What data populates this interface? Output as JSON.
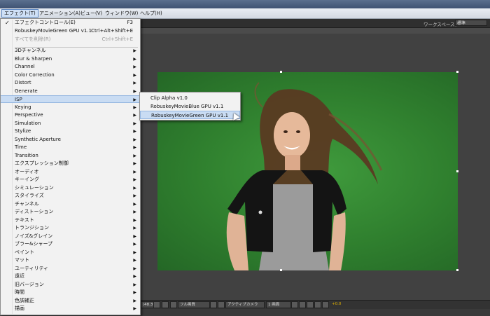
{
  "menubar": {
    "items": [
      {
        "label": "エフェクト(T)",
        "active": true
      },
      {
        "label": "アニメーション(A)",
        "active": false
      },
      {
        "label": "ビュー(V)",
        "active": false
      },
      {
        "label": "ウィンドウ(W)",
        "active": false
      },
      {
        "label": "ヘルプ(H)",
        "active": false
      }
    ]
  },
  "workspace": {
    "label": "ワークスペース：",
    "value": "標準"
  },
  "dropdown": {
    "top_items": [
      {
        "label": "エフェクトコントロール(E)",
        "shortcut": "F3",
        "checked": true,
        "disabled": false
      },
      {
        "label": "RobuskeyMovieGreen GPU v1.1",
        "shortcut": "Ctrl+Alt+Shift+E",
        "checked": false,
        "disabled": false
      },
      {
        "label": "すべてを削除(R)",
        "shortcut": "Ctrl+Shift+E",
        "checked": false,
        "disabled": true
      }
    ],
    "categories": [
      "3Dチャンネル",
      "Blur & Sharpen",
      "Channel",
      "Color Correction",
      "Distort",
      "Generate",
      "ISP",
      "Keying",
      "Perspective",
      "Simulation",
      "Stylize",
      "Synthetic Aperture",
      "Time",
      "Transition",
      "エクスプレッション制御",
      "オーディオ",
      "キーイング",
      "シミュレーション",
      "スタイライズ",
      "チャンネル",
      "ディストーション",
      "テキスト",
      "トランジション",
      "ノイズ&グレイン",
      "ブラー&シャープ",
      "ペイント",
      "マット",
      "ユーティリティ",
      "遠近",
      "旧バージョン",
      "時間",
      "色調補正",
      "描画"
    ],
    "highlighted": "ISP"
  },
  "submenu": {
    "items": [
      {
        "label": "Clip Alpha v1.0",
        "highlighted": false
      },
      {
        "label": "RobuskeyMovieBlue GPU v1.1",
        "highlighted": false
      },
      {
        "label": "RobuskeyMovieGreen GPU v1.1",
        "highlighted": true
      }
    ]
  },
  "viewer": {
    "bottom": {
      "zoom": "(48.3%)",
      "resolution": "フル画質",
      "camera": "アクティブカメラ",
      "views": "1 画面",
      "offset": "+0.0"
    },
    "green_color": "#2f7f2e"
  }
}
